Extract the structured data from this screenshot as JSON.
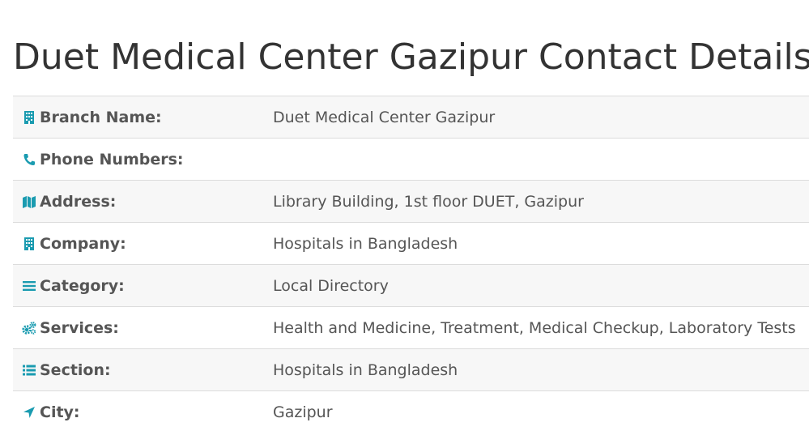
{
  "title": "Duet Medical Center Gazipur Contact Details",
  "accent_color": "#1a9bb0",
  "rows": [
    {
      "icon": "building-icon",
      "label": "Branch Name:",
      "value": "Duet Medical Center Gazipur"
    },
    {
      "icon": "phone-icon",
      "label": "Phone Numbers:",
      "value": ""
    },
    {
      "icon": "map-icon",
      "label": "Address:",
      "value": "Library Building, 1st floor DUET, Gazipur"
    },
    {
      "icon": "building-icon",
      "label": "Company:",
      "value": "Hospitals in Bangladesh"
    },
    {
      "icon": "bars-icon",
      "label": "Category:",
      "value": "Local Directory"
    },
    {
      "icon": "gears-icon",
      "label": "Services:",
      "value": "Health and Medicine, Treatment, Medical Checkup, Laboratory Tests"
    },
    {
      "icon": "list-icon",
      "label": "Section:",
      "value": "Hospitals in Bangladesh"
    },
    {
      "icon": "location-arrow-icon",
      "label": "City:",
      "value": "Gazipur"
    }
  ]
}
